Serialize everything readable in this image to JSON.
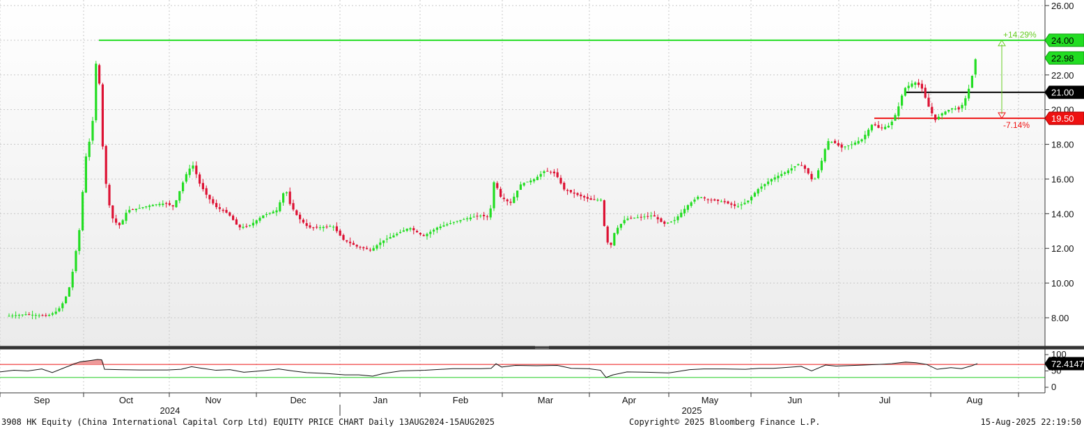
{
  "chart_data": {
    "type": "candlestick",
    "ticker_caption": "3908 HK Equity (China International Capital Corp Ltd) EQUITY PRICE CHART  Daily 13AUG2024-15AUG2025",
    "copyright": "Copyright© 2025 Bloomberg Finance L.P.",
    "timestamp": "15-Aug-2025 22:19:50",
    "price_axis": {
      "ylim": [
        6.4,
        26.2
      ],
      "ticks": [
        "8.00",
        "10.00",
        "12.00",
        "14.00",
        "16.00",
        "18.00",
        "20.00",
        "22.00",
        "24.00",
        "26.00"
      ]
    },
    "months": [
      {
        "label": "Sep",
        "dx": 60
      },
      {
        "label": "Oct",
        "dx": 181
      },
      {
        "label": "Nov",
        "dx": 306
      },
      {
        "label": "Dec",
        "dx": 428
      },
      {
        "label": "Jan",
        "dx": 546
      },
      {
        "label": "Feb",
        "dx": 661
      },
      {
        "label": "Mar",
        "dx": 783
      },
      {
        "label": "Apr",
        "dx": 903
      },
      {
        "label": "May",
        "dx": 1019
      },
      {
        "label": "Jun",
        "dx": 1141
      },
      {
        "label": "Jul",
        "dx": 1270
      },
      {
        "label": "Aug",
        "dx": 1399
      }
    ],
    "years": [
      {
        "label": "2024",
        "dx": 244
      },
      {
        "label": "2025",
        "dx": 993
      }
    ],
    "price_path": [
      [
        13,
        8.1
      ],
      [
        40,
        8.2
      ],
      [
        70,
        8.1
      ],
      [
        85,
        8.4
      ],
      [
        95,
        9.0
      ],
      [
        104,
        10.0
      ],
      [
        112,
        12.0
      ],
      [
        118,
        13.5
      ],
      [
        124,
        17.0
      ],
      [
        130,
        18.0
      ],
      [
        136,
        19.5
      ],
      [
        142,
        24.0
      ],
      [
        148,
        19.0
      ],
      [
        152,
        16.5
      ],
      [
        158,
        14.7
      ],
      [
        165,
        13.6
      ],
      [
        175,
        13.3
      ],
      [
        185,
        14.2
      ],
      [
        200,
        14.3
      ],
      [
        220,
        14.5
      ],
      [
        240,
        14.6
      ],
      [
        252,
        14.4
      ],
      [
        262,
        15.5
      ],
      [
        272,
        16.5
      ],
      [
        280,
        16.8
      ],
      [
        288,
        15.8
      ],
      [
        300,
        15.0
      ],
      [
        312,
        14.4
      ],
      [
        330,
        14.0
      ],
      [
        345,
        13.2
      ],
      [
        360,
        13.3
      ],
      [
        380,
        13.9
      ],
      [
        400,
        14.2
      ],
      [
        412,
        15.5
      ],
      [
        418,
        14.6
      ],
      [
        430,
        13.8
      ],
      [
        445,
        13.2
      ],
      [
        460,
        13.2
      ],
      [
        480,
        13.3
      ],
      [
        495,
        12.5
      ],
      [
        515,
        12.1
      ],
      [
        535,
        11.9
      ],
      [
        550,
        12.4
      ],
      [
        570,
        12.8
      ],
      [
        590,
        13.2
      ],
      [
        610,
        12.7
      ],
      [
        630,
        13.2
      ],
      [
        660,
        13.6
      ],
      [
        690,
        13.9
      ],
      [
        705,
        13.8
      ],
      [
        712,
        16.0
      ],
      [
        720,
        15.0
      ],
      [
        735,
        14.6
      ],
      [
        750,
        15.7
      ],
      [
        770,
        16.0
      ],
      [
        785,
        16.5
      ],
      [
        800,
        16.3
      ],
      [
        812,
        15.4
      ],
      [
        830,
        15.1
      ],
      [
        850,
        14.8
      ],
      [
        865,
        14.8
      ],
      [
        872,
        12.6
      ],
      [
        878,
        12.0
      ],
      [
        885,
        13.0
      ],
      [
        900,
        13.7
      ],
      [
        920,
        13.8
      ],
      [
        940,
        13.9
      ],
      [
        955,
        13.4
      ],
      [
        970,
        13.6
      ],
      [
        990,
        14.5
      ],
      [
        1005,
        15.0
      ],
      [
        1020,
        14.8
      ],
      [
        1040,
        14.7
      ],
      [
        1060,
        14.4
      ],
      [
        1075,
        14.7
      ],
      [
        1090,
        15.4
      ],
      [
        1110,
        16.0
      ],
      [
        1130,
        16.4
      ],
      [
        1150,
        16.9
      ],
      [
        1160,
        16.5
      ],
      [
        1170,
        15.8
      ],
      [
        1180,
        16.8
      ],
      [
        1190,
        18.2
      ],
      [
        1200,
        18.1
      ],
      [
        1210,
        17.8
      ],
      [
        1225,
        18.0
      ],
      [
        1240,
        18.3
      ],
      [
        1255,
        19.2
      ],
      [
        1265,
        18.9
      ],
      [
        1280,
        19.1
      ],
      [
        1290,
        19.9
      ],
      [
        1300,
        21.2
      ],
      [
        1315,
        21.6
      ],
      [
        1325,
        21.3
      ],
      [
        1335,
        20.2
      ],
      [
        1345,
        19.4
      ],
      [
        1355,
        19.8
      ],
      [
        1370,
        20.1
      ],
      [
        1380,
        20.0
      ],
      [
        1390,
        20.8
      ],
      [
        1396,
        21.6
      ],
      [
        1403,
        22.98
      ]
    ],
    "current_price": "22.98",
    "current_price_value": 22.98,
    "levels": [
      {
        "name": "resistance",
        "label": "24.00",
        "value": 24.0,
        "color": "#22dd22",
        "text_color": "#000000",
        "start_dx": 142
      },
      {
        "name": "pivot",
        "label": "21.00",
        "value": 21.0,
        "color": "#000000",
        "text_color": "#ffffff",
        "start_dx": 1299
      },
      {
        "name": "support",
        "label": "19.50",
        "value": 19.5,
        "color": "#ee1111",
        "text_color": "#ffffff",
        "start_dx": 1255
      }
    ],
    "annotations": [
      {
        "label": "+14.29%",
        "color": "#66cc22",
        "value": 24.0
      },
      {
        "label": "-7.14%",
        "color": "#ee1111",
        "value": 19.5
      }
    ],
    "rsi": {
      "ylim": [
        -10,
        110
      ],
      "ticks": [
        "0",
        "50",
        "100"
      ],
      "overbought": 70,
      "oversold": 30,
      "last_label": "72.4147",
      "last_value": 72.4147,
      "path": [
        [
          0,
          47
        ],
        [
          20,
          52
        ],
        [
          40,
          50
        ],
        [
          60,
          56
        ],
        [
          75,
          45
        ],
        [
          95,
          62
        ],
        [
          115,
          78
        ],
        [
          130,
          82
        ],
        [
          140,
          85
        ],
        [
          146,
          84
        ],
        [
          150,
          55
        ],
        [
          170,
          54
        ],
        [
          200,
          53
        ],
        [
          240,
          53
        ],
        [
          260,
          55
        ],
        [
          275,
          63
        ],
        [
          290,
          58
        ],
        [
          310,
          52
        ],
        [
          330,
          54
        ],
        [
          350,
          46
        ],
        [
          380,
          51
        ],
        [
          400,
          56
        ],
        [
          420,
          50
        ],
        [
          440,
          45
        ],
        [
          470,
          42
        ],
        [
          495,
          38
        ],
        [
          515,
          38
        ],
        [
          535,
          34
        ],
        [
          550,
          42
        ],
        [
          575,
          50
        ],
        [
          610,
          52
        ],
        [
          650,
          57
        ],
        [
          690,
          57
        ],
        [
          705,
          58
        ],
        [
          712,
          72
        ],
        [
          720,
          62
        ],
        [
          740,
          67
        ],
        [
          770,
          66
        ],
        [
          800,
          67
        ],
        [
          820,
          58
        ],
        [
          845,
          57
        ],
        [
          862,
          52
        ],
        [
          870,
          30
        ],
        [
          880,
          38
        ],
        [
          900,
          47
        ],
        [
          930,
          46
        ],
        [
          960,
          44
        ],
        [
          990,
          54
        ],
        [
          1010,
          56
        ],
        [
          1040,
          56
        ],
        [
          1070,
          55
        ],
        [
          1090,
          58
        ],
        [
          1110,
          58
        ],
        [
          1130,
          61
        ],
        [
          1150,
          64
        ],
        [
          1165,
          50
        ],
        [
          1185,
          68
        ],
        [
          1200,
          65
        ],
        [
          1240,
          68
        ],
        [
          1260,
          70
        ],
        [
          1280,
          72
        ],
        [
          1300,
          77
        ],
        [
          1315,
          75
        ],
        [
          1330,
          70
        ],
        [
          1345,
          55
        ],
        [
          1365,
          60
        ],
        [
          1380,
          57
        ],
        [
          1395,
          66
        ],
        [
          1403,
          72.4
        ]
      ],
      "fill": "#ee9999"
    },
    "colors": {
      "up": "#22dd22",
      "down": "#dd1133",
      "grid": "#c8c8c8",
      "background_top": "#ffffff",
      "background_bottom": "#ececec"
    }
  }
}
